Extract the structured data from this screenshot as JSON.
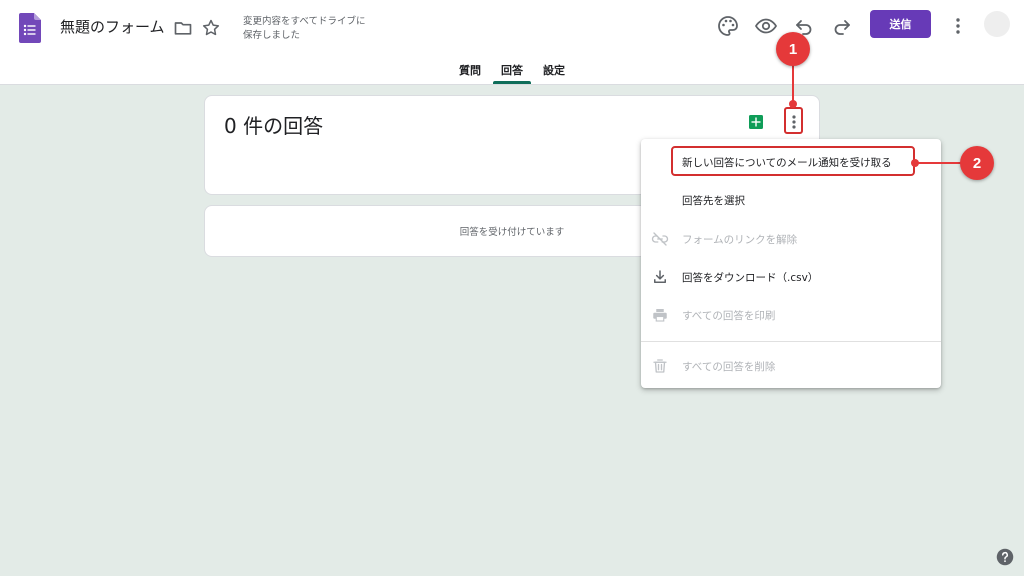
{
  "header": {
    "form_title": "無題のフォーム",
    "save_status_line1": "変更内容をすべてドライブに",
    "save_status_line2": "保存しました",
    "send_label": "送信"
  },
  "tabs": [
    {
      "label": "質問",
      "active": false
    },
    {
      "label": "回答",
      "active": true
    },
    {
      "label": "設定",
      "active": false
    }
  ],
  "summary": {
    "responses_count": "0 件の回答"
  },
  "accepting": {
    "text": "回答を受け付けています"
  },
  "menu": {
    "items": [
      {
        "label": "新しい回答についてのメール通知を受け取る",
        "icon": "",
        "enabled": true
      },
      {
        "label": "回答先を選択",
        "icon": "",
        "enabled": true
      },
      {
        "label": "フォームのリンクを解除",
        "icon": "unlink-icon",
        "enabled": false
      },
      {
        "label": "回答をダウンロード（.csv）",
        "icon": "download-icon",
        "enabled": true
      },
      {
        "label": "すべての回答を印刷",
        "icon": "print-icon",
        "enabled": false
      },
      {
        "label": "すべての回答を削除",
        "icon": "trash-icon",
        "enabled": false
      }
    ]
  },
  "annotations": {
    "step1": "1",
    "step2": "2"
  },
  "colors": {
    "accent": "#673ab7",
    "page_background": "#e3ebe7",
    "annotation_red": "#e5393a",
    "sheets_green": "#0f9d58"
  }
}
